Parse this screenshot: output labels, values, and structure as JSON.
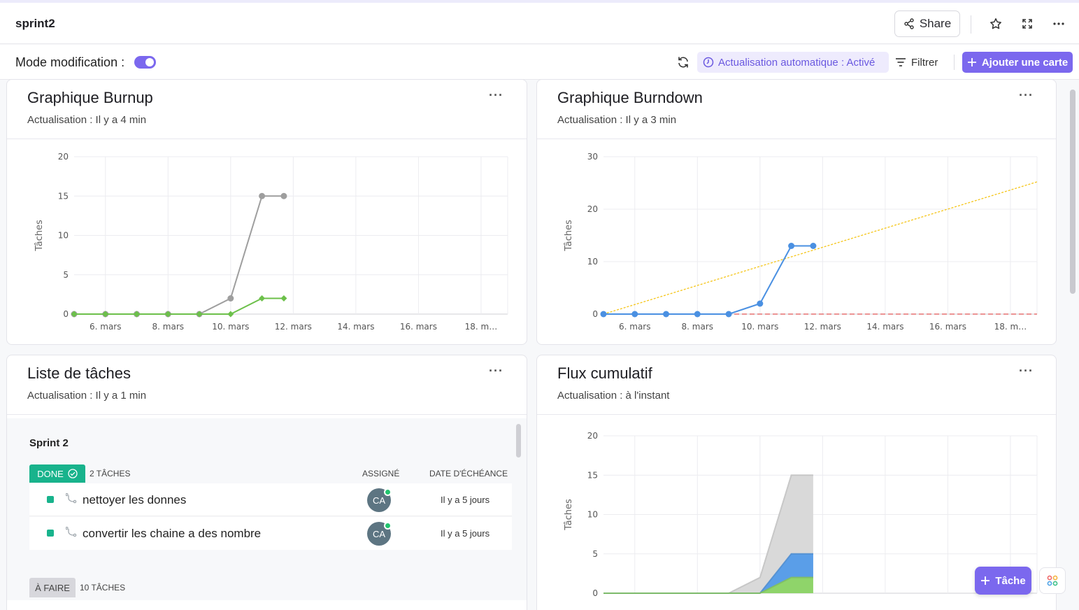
{
  "header": {
    "title": "sprint2",
    "share_label": "Share"
  },
  "toolbar": {
    "mode_label": "Mode modification :",
    "mode_enabled": true,
    "auto_refresh_label": "Actualisation automatique : Activé",
    "filter_label": "Filtrer",
    "add_card_label": "Ajouter une carte"
  },
  "cards": {
    "burnup": {
      "title": "Graphique Burnup",
      "subtitle": "Actualisation : Il y a 4 min"
    },
    "burndown": {
      "title": "Graphique Burndown",
      "subtitle": "Actualisation : Il y a 3 min"
    },
    "tasklist": {
      "title": "Liste de tâches",
      "subtitle": "Actualisation : Il y a 1 min"
    },
    "cumflow": {
      "title": "Flux cumulatif",
      "subtitle": "Actualisation : à l'instant"
    }
  },
  "tasklist": {
    "sprint_name": "Sprint 2",
    "done_label": "DONE",
    "done_count": "2 TÂCHES",
    "col_assignee": "ASSIGNÉ",
    "col_due": "DATE D'ÉCHÉANCE",
    "tasks": [
      {
        "name": "nettoyer les donnes",
        "assignee": "CA",
        "due": "Il y a 5 jours"
      },
      {
        "name": "convertir les chaine a des nombre",
        "assignee": "CA",
        "due": "Il y a 5 jours"
      }
    ],
    "todo_label": "À FAIRE",
    "todo_count": "10 TÂCHES"
  },
  "fab": {
    "task_label": "Tâche"
  },
  "colors": {
    "accent": "#7b68ee",
    "done": "#18b38c",
    "burnup_scope": "#9e9e9e",
    "burnup_done": "#6cc04a",
    "burndown_actual": "#4a90e2",
    "burndown_ideal": "#f5c518",
    "burndown_zero": "#e05555",
    "cum_todo": "#d9d9d9",
    "cum_progress": "#5a9ee8",
    "cum_done": "#8fd46a"
  },
  "chart_data": [
    {
      "id": "burnup",
      "type": "line",
      "title": "",
      "ylabel": "Tâches",
      "xlim": [
        5,
        18.85
      ],
      "ylim": [
        0,
        20
      ],
      "yticks": [
        0,
        5,
        10,
        15,
        20
      ],
      "xticks": [
        {
          "x": 6,
          "label": "6. mars"
        },
        {
          "x": 8,
          "label": "8. mars"
        },
        {
          "x": 10,
          "label": "10. mars"
        },
        {
          "x": 12,
          "label": "12. mars"
        },
        {
          "x": 14,
          "label": "14. mars"
        },
        {
          "x": 16,
          "label": "16. mars"
        },
        {
          "x": 18,
          "label": "18. m…"
        }
      ],
      "series": [
        {
          "color": "#9e9e9e",
          "marker": "circle",
          "points": [
            [
              5,
              0
            ],
            [
              6,
              0
            ],
            [
              7,
              0
            ],
            [
              8,
              0
            ],
            [
              9,
              0
            ],
            [
              10,
              2
            ],
            [
              11,
              15
            ],
            [
              11.7,
              15
            ]
          ]
        },
        {
          "color": "#6cc04a",
          "marker": "diamond",
          "points": [
            [
              5,
              0
            ],
            [
              6,
              0
            ],
            [
              7,
              0
            ],
            [
              8,
              0
            ],
            [
              9,
              0
            ],
            [
              10,
              0
            ],
            [
              11,
              2
            ],
            [
              11.7,
              2
            ]
          ]
        }
      ]
    },
    {
      "id": "burndown",
      "type": "line",
      "title": "",
      "ylabel": "Tâches",
      "xlim": [
        5,
        18.85
      ],
      "ylim": [
        0,
        30
      ],
      "yticks": [
        0,
        10,
        20,
        30
      ],
      "xticks": [
        {
          "x": 6,
          "label": "6. mars"
        },
        {
          "x": 8,
          "label": "8. mars"
        },
        {
          "x": 10,
          "label": "10. mars"
        },
        {
          "x": 12,
          "label": "12. mars"
        },
        {
          "x": 14,
          "label": "14. mars"
        },
        {
          "x": 16,
          "label": "16. mars"
        },
        {
          "x": 18,
          "label": "18. m…"
        }
      ],
      "series": [
        {
          "color": "#f5c518",
          "style": "dotted",
          "points": [
            [
              5,
              0
            ],
            [
              18.85,
              25.2
            ]
          ]
        },
        {
          "color": "#e05555",
          "style": "dashed",
          "points": [
            [
              5,
              0
            ],
            [
              18.85,
              0
            ]
          ]
        },
        {
          "color": "#4a90e2",
          "marker": "circle",
          "points": [
            [
              5,
              0
            ],
            [
              6,
              0
            ],
            [
              7,
              0
            ],
            [
              8,
              0
            ],
            [
              9,
              0
            ],
            [
              10,
              2
            ],
            [
              11,
              13
            ],
            [
              11.7,
              13
            ]
          ]
        }
      ]
    },
    {
      "id": "cumflow",
      "type": "area",
      "title": "",
      "ylabel": "Tâches",
      "xlim": [
        5,
        18.85
      ],
      "ylim": [
        0,
        20
      ],
      "yticks": [
        0,
        5,
        10,
        15,
        20
      ],
      "x": [
        5,
        6,
        7,
        8,
        9,
        10,
        11,
        11.7
      ],
      "series": [
        {
          "color": "#8fd46a",
          "values": [
            0,
            0,
            0,
            0,
            0,
            0,
            2,
            2
          ]
        },
        {
          "color": "#5a9ee8",
          "values": [
            0,
            0,
            0,
            0,
            0,
            0,
            3,
            3
          ]
        },
        {
          "color": "#d9d9d9",
          "values": [
            0,
            0,
            0,
            0,
            0,
            2,
            10,
            10
          ]
        }
      ]
    }
  ]
}
